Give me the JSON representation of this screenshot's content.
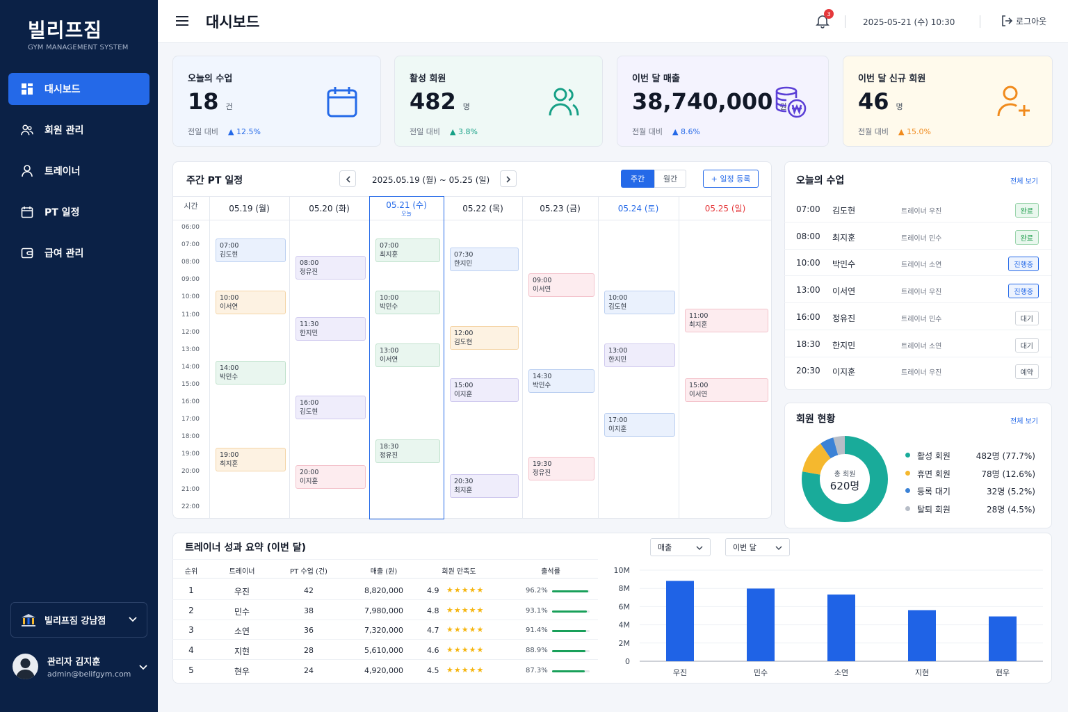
{
  "app": {
    "logo": "빌리프짐",
    "subtitle": "GYM MANAGEMENT SYSTEM"
  },
  "nav": [
    {
      "label": "대시보드",
      "icon": "grid-icon"
    },
    {
      "label": "회원 관리",
      "icon": "users-icon"
    },
    {
      "label": "트레이너",
      "icon": "user-icon"
    },
    {
      "label": "PT 일정",
      "icon": "calendar-icon"
    },
    {
      "label": "급여 관리",
      "icon": "wallet-icon"
    }
  ],
  "branch": "빌리프짐 강남점",
  "user": {
    "name": "관리자 김지훈",
    "email": "admin@belifgym.com"
  },
  "header": {
    "title": "대시보드",
    "notifications": "3",
    "datetime": "2025-05-21 (수) 10:30",
    "logout": "로그아웃"
  },
  "stats": [
    {
      "title": "오늘의 수업",
      "value": "18",
      "unit": "건",
      "compare": "전일 대비",
      "delta": "12.5%",
      "icon": "calendar-icon",
      "color": "#2469e8"
    },
    {
      "title": "활성 회원",
      "value": "482",
      "unit": "명",
      "compare": "전일 대비",
      "delta": "3.8%",
      "icon": "users-icon",
      "color": "#16a086"
    },
    {
      "title": "이번 달 매출",
      "value": "38,740,000",
      "unit": "원",
      "compare": "전월 대비",
      "delta": "8.6%",
      "icon": "coins-icon",
      "color": "#5b3fd6"
    },
    {
      "title": "이번 달 신규 회원",
      "value": "46",
      "unit": "명",
      "compare": "전월 대비",
      "delta": "15.0%",
      "icon": "user-plus-icon",
      "color": "#f08a1c"
    }
  ],
  "schedule": {
    "title": "주간 PT 일정",
    "range": "2025.05.19 (월) ~ 05.25 (일)",
    "tab_week": "주간",
    "tab_month": "월간",
    "add": "+ 일정 등록",
    "time_header": "시간",
    "today_label": "오늘",
    "days": [
      "05.19 (월)",
      "05.20 (화)",
      "05.21 (수)",
      "05.22 (목)",
      "05.23 (금)",
      "05.24 (토)",
      "05.25 (일)"
    ],
    "hours": [
      "06:00",
      "07:00",
      "08:00",
      "09:00",
      "10:00",
      "11:00",
      "12:00",
      "13:00",
      "14:00",
      "15:00",
      "16:00",
      "17:00",
      "18:00",
      "19:00",
      "20:00",
      "21:00",
      "22:00"
    ],
    "events": [
      {
        "day": 0,
        "start": 7.0,
        "time": "07:00",
        "name": "김도현",
        "color": "blue"
      },
      {
        "day": 0,
        "start": 10.0,
        "time": "10:00",
        "name": "이서연",
        "color": "orange"
      },
      {
        "day": 0,
        "start": 14.0,
        "time": "14:00",
        "name": "박민수",
        "color": "green"
      },
      {
        "day": 0,
        "start": 19.0,
        "time": "19:00",
        "name": "최지훈",
        "color": "orange"
      },
      {
        "day": 1,
        "start": 8.0,
        "time": "08:00",
        "name": "정유진",
        "color": "purple"
      },
      {
        "day": 1,
        "start": 11.5,
        "time": "11:30",
        "name": "한지민",
        "color": "purple"
      },
      {
        "day": 1,
        "start": 16.0,
        "time": "16:00",
        "name": "김도현",
        "color": "purple"
      },
      {
        "day": 1,
        "start": 20.0,
        "time": "20:00",
        "name": "이지훈",
        "color": "pink"
      },
      {
        "day": 2,
        "start": 7.0,
        "time": "07:00",
        "name": "최지훈",
        "color": "green"
      },
      {
        "day": 2,
        "start": 10.0,
        "time": "10:00",
        "name": "박민수",
        "color": "green"
      },
      {
        "day": 2,
        "start": 13.0,
        "time": "13:00",
        "name": "이서연",
        "color": "green"
      },
      {
        "day": 2,
        "start": 18.5,
        "time": "18:30",
        "name": "정유진",
        "color": "green"
      },
      {
        "day": 3,
        "start": 7.5,
        "time": "07:30",
        "name": "한지민",
        "color": "blue"
      },
      {
        "day": 3,
        "start": 12.0,
        "time": "12:00",
        "name": "김도현",
        "color": "orange"
      },
      {
        "day": 3,
        "start": 15.0,
        "time": "15:00",
        "name": "이지훈",
        "color": "purple"
      },
      {
        "day": 3,
        "start": 20.5,
        "time": "20:30",
        "name": "최지훈",
        "color": "purple"
      },
      {
        "day": 4,
        "start": 9.0,
        "time": "09:00",
        "name": "이서연",
        "color": "pink"
      },
      {
        "day": 4,
        "start": 14.5,
        "time": "14:30",
        "name": "박민수",
        "color": "blue"
      },
      {
        "day": 4,
        "start": 19.5,
        "time": "19:30",
        "name": "정유진",
        "color": "pink"
      },
      {
        "day": 5,
        "start": 10.0,
        "time": "10:00",
        "name": "김도현",
        "color": "blue"
      },
      {
        "day": 5,
        "start": 13.0,
        "time": "13:00",
        "name": "한지민",
        "color": "purple"
      },
      {
        "day": 5,
        "start": 17.0,
        "time": "17:00",
        "name": "이지훈",
        "color": "blue"
      },
      {
        "day": 6,
        "start": 11.0,
        "time": "11:00",
        "name": "최지훈",
        "color": "pink"
      },
      {
        "day": 6,
        "start": 15.0,
        "time": "15:00",
        "name": "이서연",
        "color": "pink"
      }
    ]
  },
  "today": {
    "title": "오늘의 수업",
    "view_all": "전체 보기",
    "rows": [
      {
        "time": "07:00",
        "member": "김도현",
        "trainer": "트레이너 우진",
        "status": "완료",
        "kind": "done"
      },
      {
        "time": "08:00",
        "member": "최지훈",
        "trainer": "트레이너 민수",
        "status": "완료",
        "kind": "done"
      },
      {
        "time": "10:00",
        "member": "박민수",
        "trainer": "트레이너 소연",
        "status": "진행중",
        "kind": "progress"
      },
      {
        "time": "13:00",
        "member": "이서연",
        "trainer": "트레이너 우진",
        "status": "진행중",
        "kind": "progress"
      },
      {
        "time": "16:00",
        "member": "정유진",
        "trainer": "트레이너 민수",
        "status": "대기",
        "kind": "wait"
      },
      {
        "time": "18:30",
        "member": "한지민",
        "trainer": "트레이너 소연",
        "status": "대기",
        "kind": "wait"
      },
      {
        "time": "20:30",
        "member": "이지훈",
        "trainer": "트레이너 우진",
        "status": "예약",
        "kind": "wait"
      }
    ]
  },
  "members": {
    "title": "회원 현황",
    "view_all": "전체 보기",
    "center_label": "총 회원",
    "center_value": "620명",
    "items": [
      {
        "label": "활성 회원",
        "value": "482명 (77.7%)",
        "pct": 77.7,
        "color": "#19ab9a"
      },
      {
        "label": "휴면 회원",
        "value": "78명 (12.6%)",
        "pct": 12.6,
        "color": "#f5b82e"
      },
      {
        "label": "등록 대기",
        "value": "32명 (5.2%)",
        "pct": 5.2,
        "color": "#3b82d6"
      },
      {
        "label": "탈퇴 회원",
        "value": "28명 (4.5%)",
        "pct": 4.5,
        "color": "#b7bdc7"
      }
    ]
  },
  "trainers": {
    "title": "트레이너 성과 요약 (이번 달)",
    "filter_metric": "매출",
    "filter_period": "이번 달",
    "headers": [
      "순위",
      "트레이너",
      "PT 수업 (건)",
      "매출 (원)",
      "회원 만족도",
      "출석률"
    ],
    "rows": [
      {
        "rank": "1",
        "name": "우진",
        "pt": "42",
        "sales": "8,820,000",
        "rating": "4.9",
        "attend": "96.2%",
        "attend_pct": 96.2
      },
      {
        "rank": "2",
        "name": "민수",
        "pt": "38",
        "sales": "7,980,000",
        "rating": "4.8",
        "attend": "93.1%",
        "attend_pct": 93.1
      },
      {
        "rank": "3",
        "name": "소연",
        "pt": "36",
        "sales": "7,320,000",
        "rating": "4.7",
        "attend": "91.4%",
        "attend_pct": 91.4
      },
      {
        "rank": "4",
        "name": "지현",
        "pt": "28",
        "sales": "5,610,000",
        "rating": "4.6",
        "attend": "88.9%",
        "attend_pct": 88.9
      },
      {
        "rank": "5",
        "name": "현우",
        "pt": "24",
        "sales": "4,920,000",
        "rating": "4.5",
        "attend": "87.3%",
        "attend_pct": 87.3
      }
    ]
  },
  "chart_data": {
    "type": "bar",
    "categories": [
      "우진",
      "민수",
      "소연",
      "지현",
      "현우"
    ],
    "values": [
      8820000,
      7980000,
      7320000,
      5610000,
      4920000
    ],
    "yticks": [
      "10M",
      "8M",
      "6M",
      "4M",
      "2M",
      "0"
    ],
    "ylim": [
      0,
      10000000
    ],
    "color": "#1f63e6",
    "title": "",
    "xlabel": "",
    "ylabel": ""
  }
}
